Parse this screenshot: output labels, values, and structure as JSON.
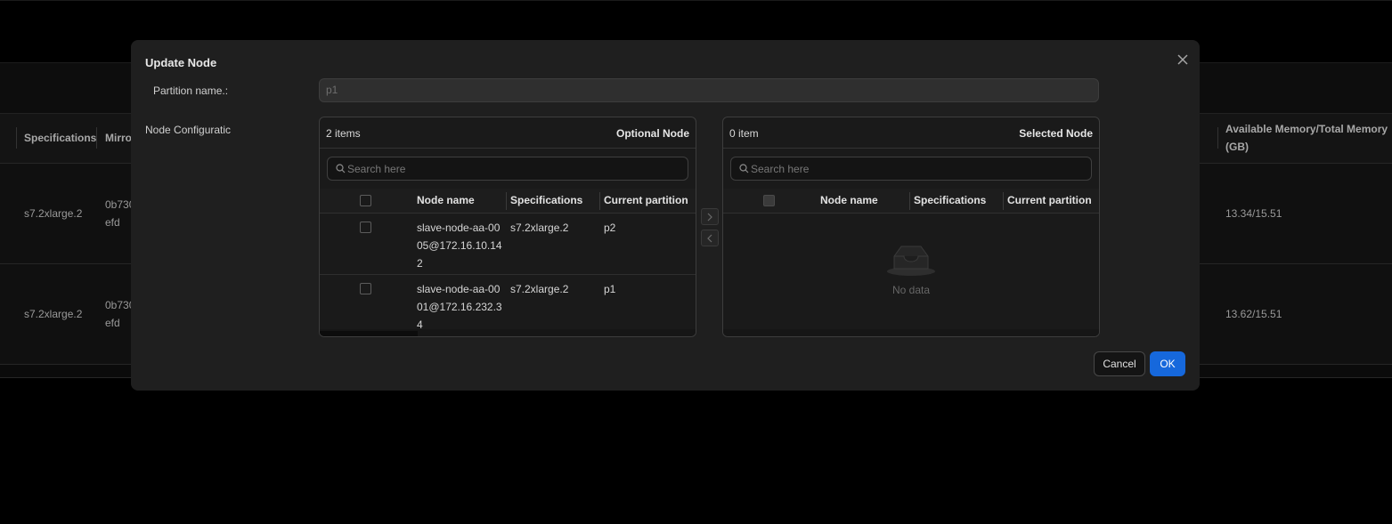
{
  "background": {
    "columns": {
      "specifications": "Specifications",
      "mirror": "Mirro",
      "memory_line1": "Available Memory/Total Memory",
      "memory_line2": "(GB)"
    },
    "rows": [
      {
        "spec": "s7.2xlarge.2",
        "mirror_line1": "0b730",
        "mirror_line2": "efd",
        "memory": "13.34/15.51"
      },
      {
        "spec": "s7.2xlarge.2",
        "mirror_line1": "0b730",
        "mirror_line2": "efd",
        "memory": "13.62/15.51"
      }
    ]
  },
  "modal": {
    "title": "Update Node",
    "partition_label": "Partition name.:",
    "partition_value": "p1",
    "node_config_label": "Node Configuratic",
    "transfer": {
      "left": {
        "count": "2 items",
        "title": "Optional Node",
        "search_placeholder": "Search here",
        "columns": {
          "name": "Node name",
          "spec": "Specifications",
          "partition": "Current partition"
        },
        "rows": [
          {
            "name": "slave-node-aa-0005@172.16.10.142",
            "spec": "s7.2xlarge.2",
            "partition": "p2"
          },
          {
            "name": "slave-node-aa-0001@172.16.232.34",
            "spec": "s7.2xlarge.2",
            "partition": "p1"
          }
        ]
      },
      "right": {
        "count": "0 item",
        "title": "Selected Node",
        "search_placeholder": "Search here",
        "columns": {
          "name": "Node name",
          "spec": "Specifications",
          "partition": "Current partition"
        },
        "empty_text": "No data"
      }
    },
    "cancel_label": "Cancel",
    "ok_label": "OK"
  },
  "icons": {
    "close": "close-icon",
    "search": "search-icon",
    "move_right": "chevron-right-icon",
    "move_left": "chevron-left-icon",
    "empty": "empty-inbox-icon"
  },
  "colors": {
    "primary": "#1668dc",
    "modal_bg": "#1f1f1f",
    "page_bg": "#000000"
  }
}
